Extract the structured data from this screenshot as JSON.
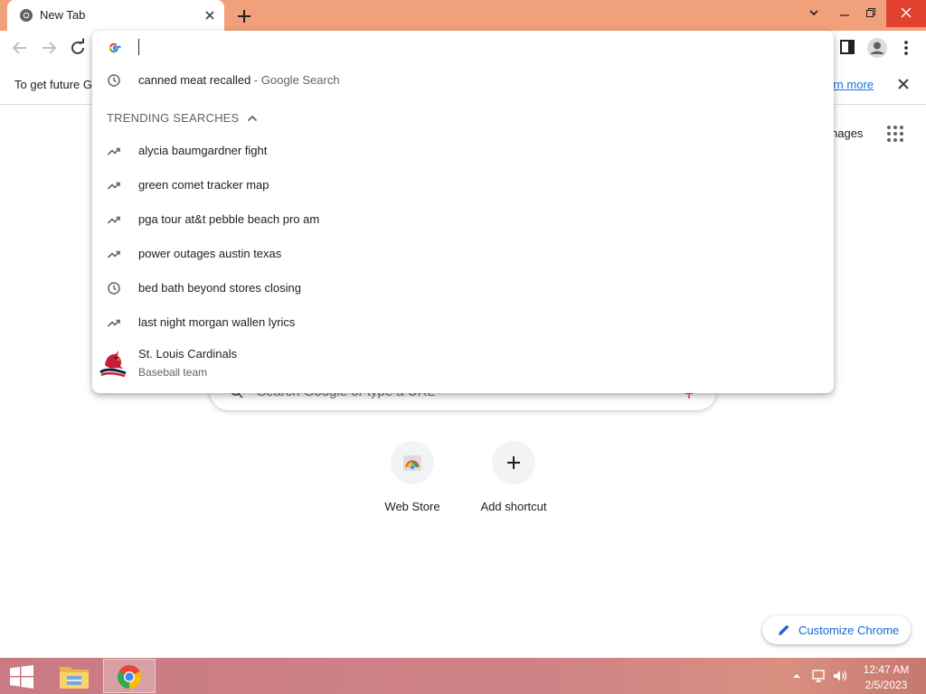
{
  "browser": {
    "tab": {
      "title": "New Tab",
      "favicon": "chrome-icon"
    },
    "infobar": {
      "text": "To get future G",
      "link": "arn more"
    }
  },
  "omnibox": {
    "input_value": "",
    "history_row": {
      "query": "canned meat recalled",
      "separator": " - ",
      "source": "Google Search"
    },
    "trending_header": "TRENDING SEARCHES",
    "suggestions": [
      {
        "icon": "trending-icon",
        "text": "alycia baumgardner fight"
      },
      {
        "icon": "trending-icon",
        "text": "green comet tracker map"
      },
      {
        "icon": "trending-icon",
        "text": "pga tour at&t pebble beach pro am"
      },
      {
        "icon": "trending-icon",
        "text": "power outages austin texas"
      },
      {
        "icon": "history-icon",
        "text": "bed bath beyond stores closing"
      },
      {
        "icon": "trending-icon",
        "text": "last night morgan wallen lyrics"
      }
    ],
    "entity": {
      "title": "St. Louis Cardinals",
      "subtitle": "Baseball team",
      "logo": "cardinals-logo"
    }
  },
  "ntp": {
    "images_link": "nages",
    "search_placeholder": "Search Google or type a URL",
    "shortcuts": [
      {
        "label": "Web Store",
        "icon": "web-store-icon"
      },
      {
        "label": "Add shortcut",
        "icon": "plus-icon"
      }
    ],
    "customize_label": "Customize Chrome"
  },
  "taskbar": {
    "time": "12:47 AM",
    "date": "2/5/2023"
  },
  "colors": {
    "titlebar": "#f0a07a",
    "close_button": "#e2412f",
    "link_blue": "#1a73e8",
    "taskbar": "#cf8386"
  }
}
